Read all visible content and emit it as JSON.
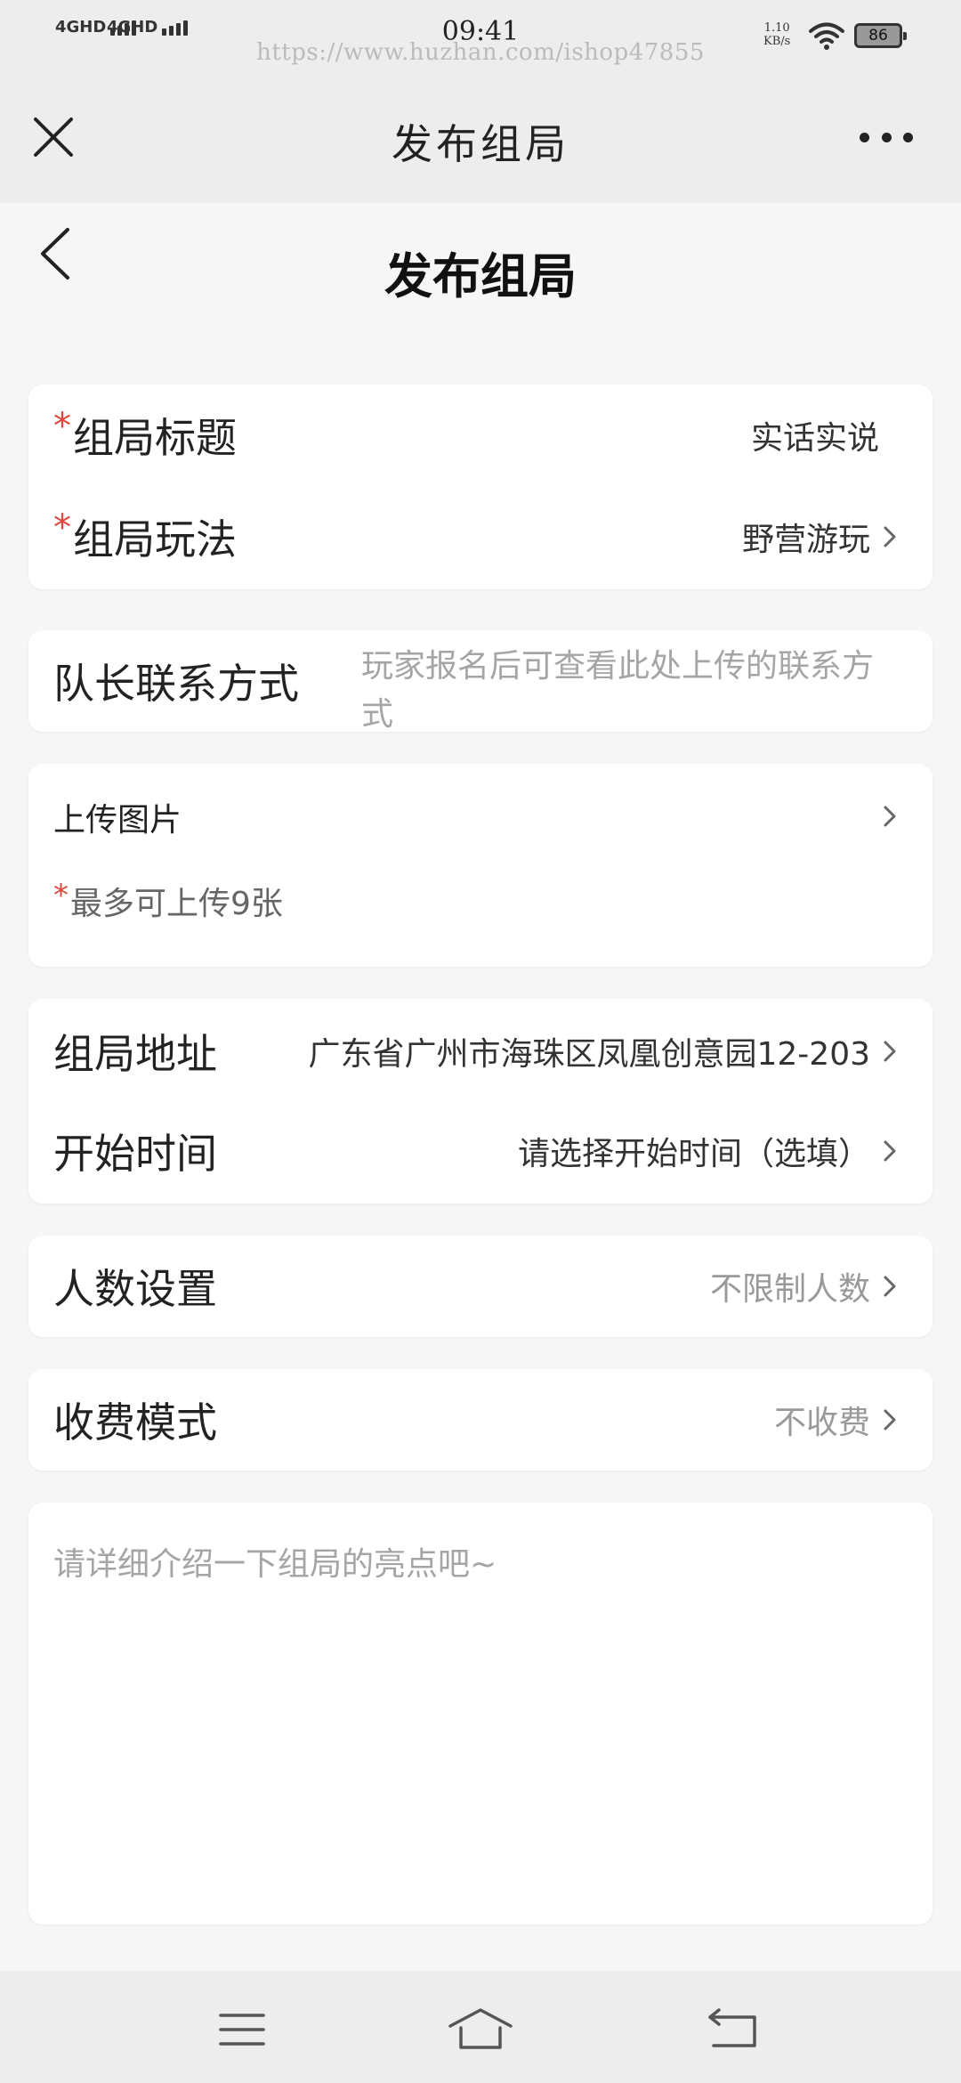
{
  "status_bar": {
    "signal1": "4GHD",
    "signal2": "4GHD",
    "time": "09:41",
    "watermark": "https://www.huzhan.com/ishop47855",
    "speed_value": "1.10",
    "speed_unit": "KB/s",
    "battery": "86"
  },
  "nav": {
    "title": "发布组局"
  },
  "page": {
    "title": "发布组局"
  },
  "basic": {
    "title_label": "组局标题",
    "title_value": "实话实说",
    "play_label": "组局玩法",
    "play_value": "野营游玩",
    "required_mark": "*"
  },
  "contact": {
    "label": "队长联系方式",
    "placeholder": "玩家报名后可查看此处上传的联系方式"
  },
  "upload": {
    "label": "上传图片",
    "required_mark": "*",
    "note": "最多可上传9张"
  },
  "location": {
    "address_label": "组局地址",
    "address_value": "广东省广州市海珠区凤凰创意园12-203",
    "start_label": "开始时间",
    "start_value": "请选择开始时间（选填）"
  },
  "people": {
    "label": "人数设置",
    "value": "不限制人数"
  },
  "fee": {
    "label": "收费模式",
    "value": "不收费"
  },
  "description": {
    "placeholder": "请详细介绍一下组局的亮点吧~"
  },
  "colors": {
    "required": "#e0453b",
    "background": "#f6f6f6",
    "bar": "#ededed"
  }
}
